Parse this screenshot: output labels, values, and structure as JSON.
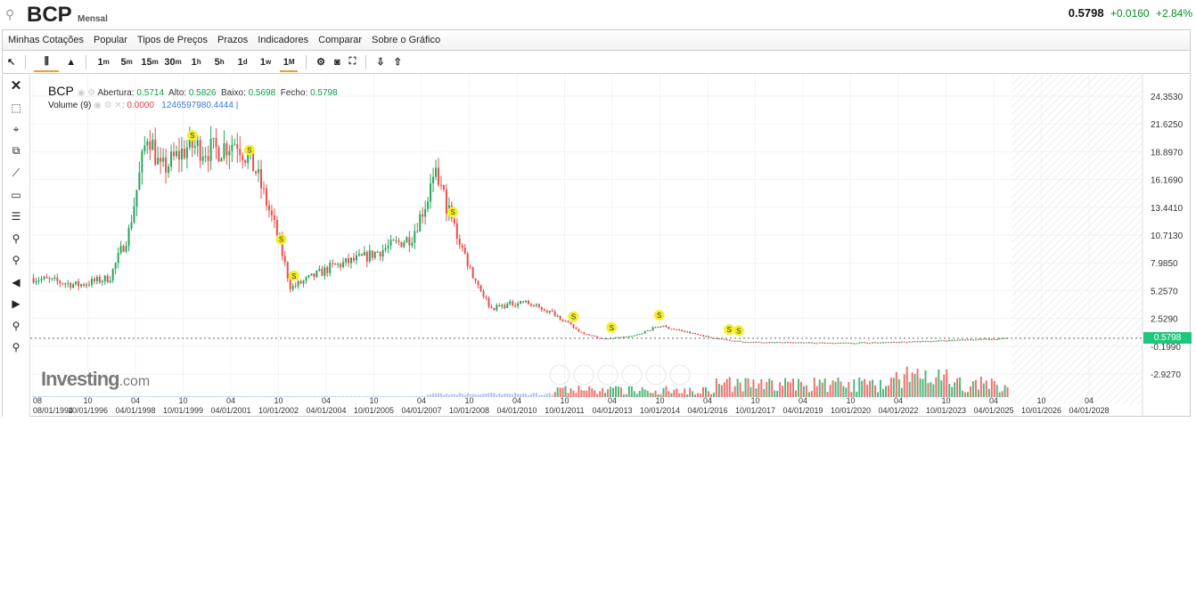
{
  "header": {
    "symbol": "BCP",
    "period": "Mensal",
    "last": "0.5798",
    "change": "+0.0160",
    "change_pct": "+2.84%"
  },
  "menu": [
    "Minhas Cotações",
    "Popular",
    "Tipos de Preços",
    "Prazos",
    "Indicadores",
    "Comparar",
    "Sobre o Gráfico"
  ],
  "toolbar": {
    "intervals": [
      {
        "n": "1",
        "u": "m"
      },
      {
        "n": "5",
        "u": "m"
      },
      {
        "n": "15",
        "u": "m"
      },
      {
        "n": "30",
        "u": "m"
      },
      {
        "n": "1",
        "u": "h"
      },
      {
        "n": "5",
        "u": "h"
      },
      {
        "n": "1",
        "u": "d"
      },
      {
        "n": "1",
        "u": "w"
      },
      {
        "n": "1",
        "u": "M"
      }
    ],
    "active_interval": "1M"
  },
  "legend": {
    "symbol": "BCP",
    "open_label": "Abertura:",
    "open": "0.5714",
    "high_label": "Alto:",
    "high": "0.5826",
    "low_label": "Baixo:",
    "low": "0.5698",
    "close_label": "Fecho:",
    "close": "0.5798",
    "volume_label": "Volume (9)",
    "volume_ma": ": 0.0000",
    "volume": "1246597980.4444 |"
  },
  "logo": {
    "main": "Investing",
    "suffix": ".com"
  },
  "colors": {
    "up": "#26a65b",
    "down": "#e8504e",
    "accent": "#f0a020",
    "last_label": "#1ec87a"
  },
  "chart_data": {
    "type": "candlestick",
    "y_ticks": [
      "24.3530",
      "21.6250",
      "18.8970",
      "16.1690",
      "13.4410",
      "10.7130",
      "7.9850",
      "5.2570",
      "2.5290",
      "-0.1990",
      "-2.9270"
    ],
    "ylim": [
      -2.927,
      24.353
    ],
    "x_ticks": [
      [
        "08",
        "08/01/1994"
      ],
      [
        "10",
        "10/01/1996"
      ],
      [
        "04",
        "04/01/1998"
      ],
      [
        "10",
        "10/01/1999"
      ],
      [
        "04",
        "04/01/2001"
      ],
      [
        "10",
        "10/01/2002"
      ],
      [
        "04",
        "04/01/2004"
      ],
      [
        "10",
        "10/01/2005"
      ],
      [
        "04",
        "04/01/2007"
      ],
      [
        "10",
        "10/01/2008"
      ],
      [
        "04",
        "04/01/2010"
      ],
      [
        "10",
        "10/01/2011"
      ],
      [
        "04",
        "04/01/2013"
      ],
      [
        "10",
        "10/01/2014"
      ],
      [
        "04",
        "04/01/2016"
      ],
      [
        "10",
        "10/01/2017"
      ],
      [
        "04",
        "04/01/2019"
      ],
      [
        "10",
        "10/01/2020"
      ],
      [
        "04",
        "04/01/2022"
      ],
      [
        "10",
        "10/01/2023"
      ],
      [
        "04",
        "04/01/2025"
      ],
      [
        "10",
        "10/01/2026"
      ],
      [
        "04",
        "04/01/2028"
      ]
    ],
    "price_keypoints": [
      [
        1994.6,
        6.5
      ],
      [
        1996.0,
        5.8
      ],
      [
        1997.0,
        6.5
      ],
      [
        1997.6,
        11
      ],
      [
        1998.2,
        21
      ],
      [
        1998.6,
        17
      ],
      [
        1999.5,
        19.5
      ],
      [
        2000.3,
        19
      ],
      [
        2001.0,
        20
      ],
      [
        2001.6,
        17
      ],
      [
        2002.3,
        10.5
      ],
      [
        2002.7,
        5.5
      ],
      [
        2003.5,
        6.8
      ],
      [
        2004.0,
        7.6
      ],
      [
        2005.0,
        8.5
      ],
      [
        2006.5,
        10.5
      ],
      [
        2007.3,
        16.5
      ],
      [
        2007.9,
        11
      ],
      [
        2008.4,
        7
      ],
      [
        2009.0,
        3.5
      ],
      [
        2010.0,
        4.2
      ],
      [
        2011.0,
        3
      ],
      [
        2011.8,
        1.2
      ],
      [
        2012.5,
        0.5
      ],
      [
        2013.5,
        0.8
      ],
      [
        2014.3,
        1.8
      ],
      [
        2015.0,
        1.3
      ],
      [
        2016.0,
        0.6
      ],
      [
        2017.0,
        0.2
      ],
      [
        2020.0,
        0.1
      ],
      [
        2022.0,
        0.2
      ],
      [
        2025.3,
        0.58
      ]
    ],
    "dividend_markers": [
      [
        1999.6,
        "S"
      ],
      [
        2001.4,
        "S"
      ],
      [
        2002.4,
        "S"
      ],
      [
        2002.8,
        "S"
      ],
      [
        2007.8,
        "S"
      ],
      [
        2011.6,
        "S"
      ],
      [
        2012.8,
        "S"
      ],
      [
        2014.3,
        "S"
      ],
      [
        2016.5,
        "S"
      ],
      [
        2016.8,
        "S"
      ]
    ],
    "last_value": "0.5798"
  }
}
